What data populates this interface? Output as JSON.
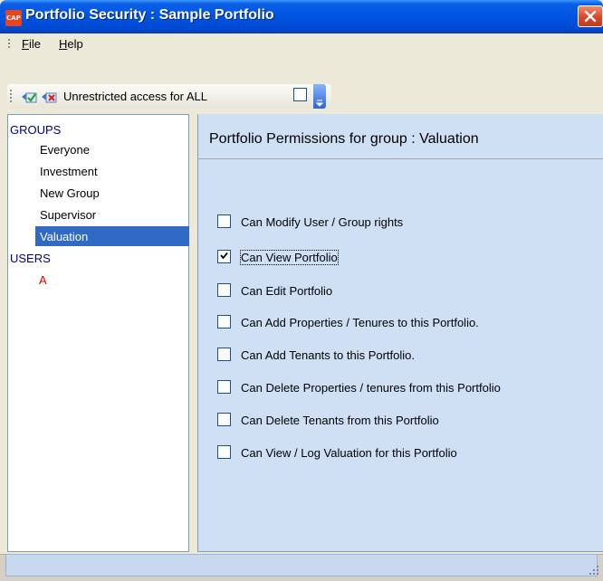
{
  "window": {
    "app_icon": "CAP",
    "title": "Portfolio Security : Sample Portfolio"
  },
  "menu": {
    "file": "File",
    "file_mnemonic": "F",
    "file_rest": "ile",
    "help": "Help",
    "help_mnemonic": "H",
    "help_rest": "elp"
  },
  "toolbar": {
    "label": "Unrestricted access for ALL",
    "checked": false
  },
  "tree": {
    "groups_header": "GROUPS",
    "groups": [
      "Everyone",
      "Investment",
      "New Group",
      "Supervisor",
      "Valuation"
    ],
    "selected_group": "Valuation",
    "users_header": "USERS",
    "users": [
      "A"
    ]
  },
  "panel": {
    "title": "Portfolio Permissions for group : Valuation",
    "permissions": [
      {
        "label": "Can Modify User / Group rights",
        "checked": false
      },
      {
        "label": "Can View Portfolio",
        "checked": true
      },
      {
        "label": "Can Edit Portfolio",
        "checked": false
      },
      {
        "label": "Can Add Properties / Tenures to this Portfolio.",
        "checked": false
      },
      {
        "label": "Can Add Tenants to this Portfolio.",
        "checked": false
      },
      {
        "label": "Can Delete Properties / tenures from this Portfolio",
        "checked": false
      },
      {
        "label": "Can Delete Tenants from this Portfolio",
        "checked": false
      },
      {
        "label": "Can View / Log Valuation for this Portfolio",
        "checked": false
      }
    ]
  },
  "icons": {
    "app": "cap-logo-icon",
    "close": "close-icon",
    "grip": "toolbar-grip-icon",
    "grant_all": "grant-all-icon",
    "revoke_all": "revoke-all-icon",
    "overflow": "chevron-down-icon",
    "resize": "resize-grip-icon"
  },
  "colors": {
    "titlebar": "#0054e3",
    "selection": "#316ac5",
    "panel_bg": "#cfe0f5",
    "user_text": "#cc0000",
    "group_header": "#000080"
  }
}
